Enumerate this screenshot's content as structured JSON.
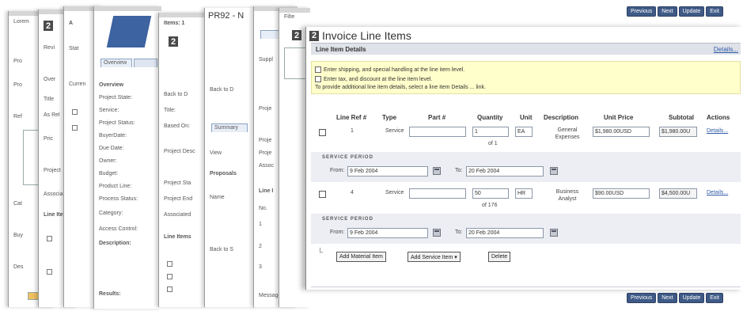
{
  "nav_buttons_top": [
    "Previous",
    "Next",
    "Update",
    "Exit"
  ],
  "nav_buttons_bottom": [
    "Previous",
    "Next",
    "Update",
    "Exit"
  ],
  "background_cards": {
    "card_pr92_title": "PR92 - N",
    "card_items_header": "Items: 1",
    "card_overview_tab": "Overview",
    "card_overview_labels": [
      "Overview",
      "Project State:",
      "Service:",
      "Project Status:",
      "BuyerDate:",
      "Due Date:",
      "Owner:",
      "Budget:",
      "Product Line:",
      "Process Status:",
      "Category:",
      "Access Control:",
      "Description:",
      "Results:"
    ],
    "card_line_items": "Line Items",
    "card_back": "Back to D",
    "card_summary": "Summary",
    "card_messages": "Messages",
    "card_step2": "2"
  },
  "panel": {
    "step": "2",
    "title": "Invoice Line Items",
    "section": "Line Item Details",
    "details_link": "Details...",
    "note": {
      "line1": "Enter shipping, and special handling at the line item level.",
      "line2": "Enter tax, and discount at the line item level.",
      "line3": "To provide additional line item details, select a line item Details ... link."
    },
    "columns": [
      "Line Ref #",
      "Type",
      "Part #",
      "Quantity",
      "Unit",
      "Description",
      "Unit Price",
      "Subtotal",
      "Actions"
    ],
    "rows": [
      {
        "ref": "1",
        "type": "Service",
        "part": "",
        "quantity": "1",
        "quantity_of": "of 1",
        "unit": "EA",
        "description": "General Expenses",
        "unit_price": "$1,980.00USD",
        "subtotal": "$1,980.00U",
        "action": "Details...",
        "period_label": "SERVICE PERIOD",
        "from_label": "From:",
        "from_value": "9 Feb 2004",
        "to_label": "To:",
        "to_value": "20 Feb 2004"
      },
      {
        "ref": "4",
        "type": "Service",
        "part": "",
        "quantity": "50",
        "quantity_of": "of 176",
        "unit": "HR",
        "description": "Business Analyst",
        "unit_price": "$90.00USD",
        "subtotal": "$4,500.00U",
        "action": "Details...",
        "period_label": "SERVICE PERIOD",
        "from_label": "From:",
        "from_value": "9 Feb 2004",
        "to_label": "To:",
        "to_value": "20 Feb 2004"
      }
    ],
    "actions": [
      "Add Material Item",
      "Add Service Item ▾",
      "Delete"
    ]
  }
}
